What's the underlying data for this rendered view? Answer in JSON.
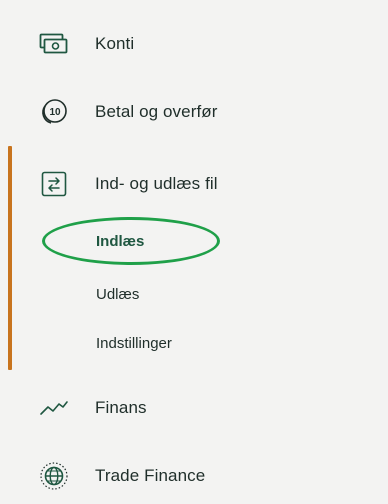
{
  "nav": {
    "items": [
      {
        "id": "konti",
        "label": "Konti",
        "icon": "banknote-icon"
      },
      {
        "id": "betal",
        "label": "Betal og overfør",
        "icon": "coin-10-icon"
      },
      {
        "id": "indudlaes",
        "label": "Ind- og udlæs fil",
        "icon": "transfer-arrows-icon",
        "active": true
      },
      {
        "id": "finans",
        "label": "Finans",
        "icon": "trend-line-icon"
      },
      {
        "id": "trade",
        "label": "Trade Finance",
        "icon": "globe-icon"
      }
    ],
    "subitems": [
      {
        "label": "Indlæs",
        "selected": true
      },
      {
        "label": "Udlæs"
      },
      {
        "label": "Indstillinger"
      }
    ],
    "coin_text": "10"
  },
  "colors": {
    "background": "#f3f3f2",
    "text": "#1f2e2a",
    "active_bar": "#c8741e",
    "selected_sub": "#1f5741",
    "highlight": "#1fa049",
    "icon_green": "#1f5741"
  }
}
